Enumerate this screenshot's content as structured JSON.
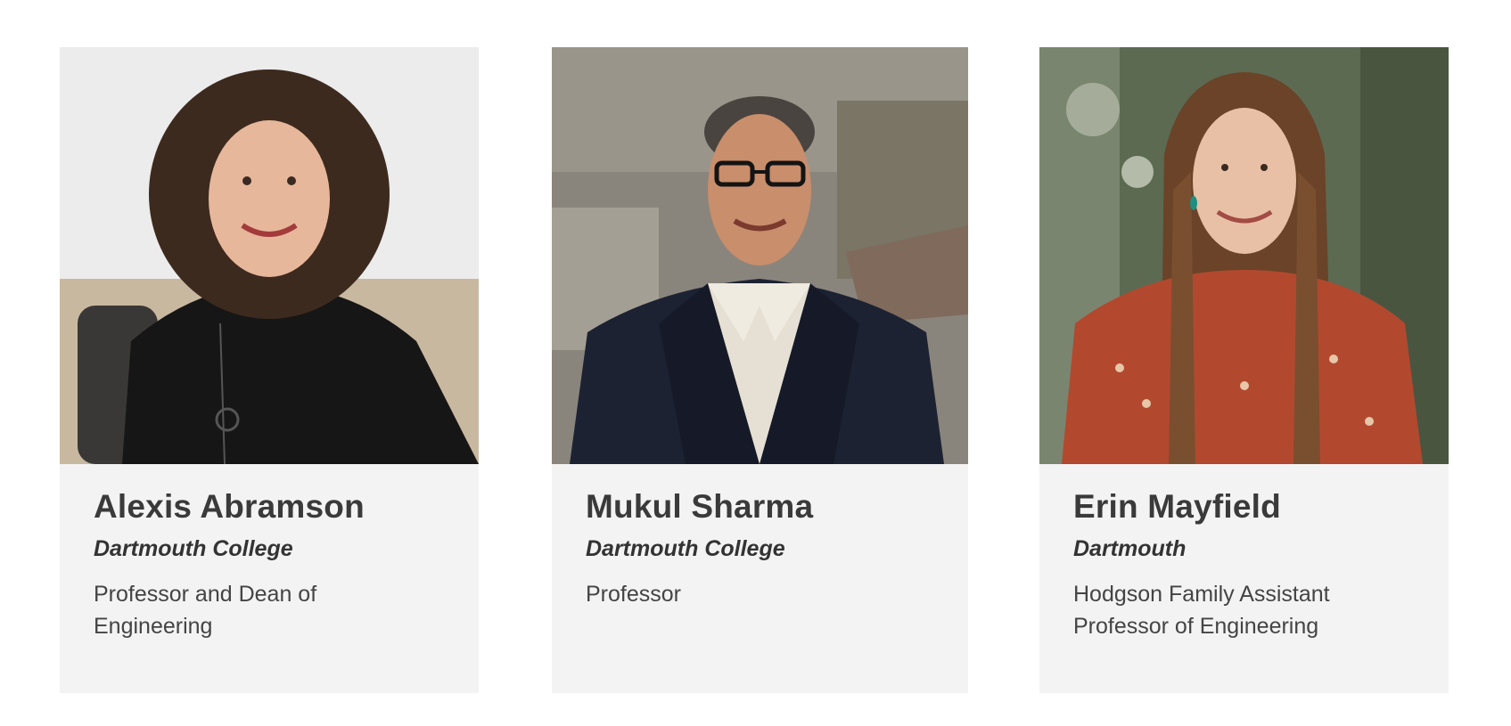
{
  "people": [
    {
      "name": "Alexis Abramson",
      "organization": "Dartmouth College",
      "title": "Professor and Dean of Engineering"
    },
    {
      "name": "Mukul Sharma",
      "organization": "Dartmouth College",
      "title": "Professor"
    },
    {
      "name": "Erin Mayfield",
      "organization": "Dartmouth",
      "title": "Hodgson Family Assistant Professor of Engineering"
    }
  ],
  "colors": {
    "card_background": "#f3f3f3",
    "name_text": "#3a3a3a",
    "body_text": "#444444"
  }
}
